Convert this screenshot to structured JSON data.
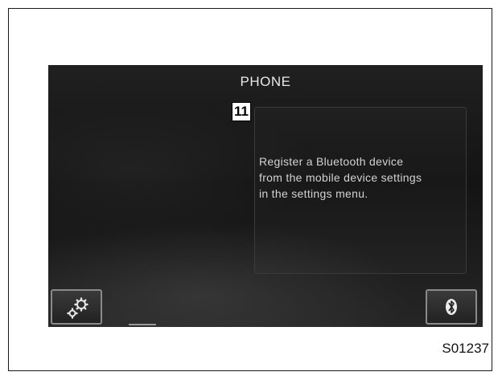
{
  "screen": {
    "title": "PHONE",
    "callout_number": "11",
    "message": "Register a Bluetooth device from the mobile device settings in the settings menu."
  },
  "buttons": {
    "settings_icon": "settings-gears-icon",
    "bluetooth_icon": "bluetooth-icon"
  },
  "figure_id": "S01237",
  "colors": {
    "screen_background": "#1a1a1a",
    "screen_text": "#d2d2d2",
    "button_border": "#8a8a8a"
  }
}
